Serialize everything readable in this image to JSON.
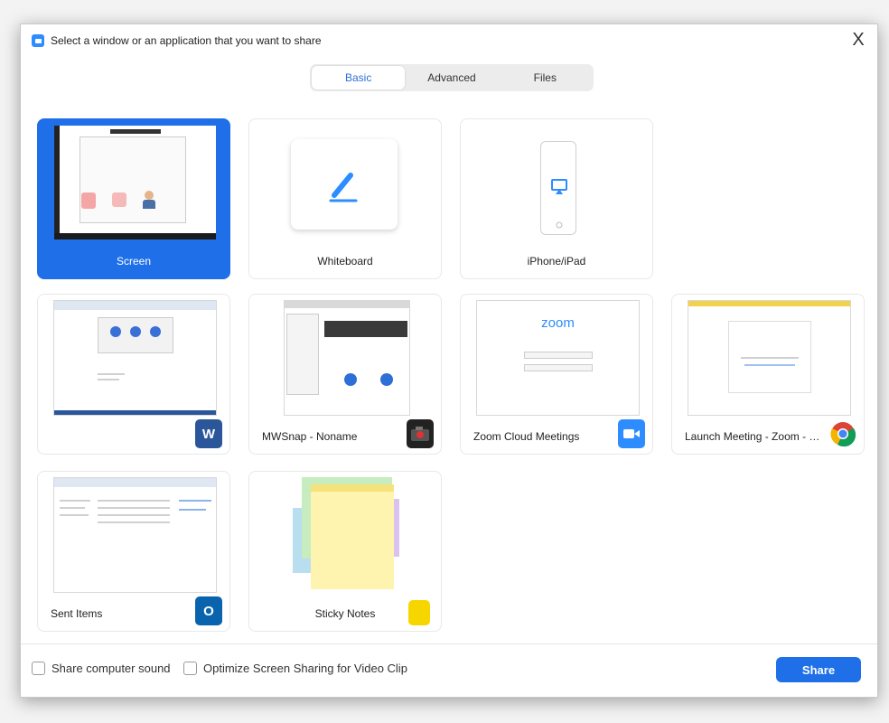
{
  "dialog": {
    "title": "Select a window or an application that you want to share",
    "close_glyph": "X"
  },
  "tabs": [
    {
      "label": "Basic",
      "active": true
    },
    {
      "label": "Advanced",
      "active": false
    },
    {
      "label": "Files",
      "active": false
    }
  ],
  "cards": {
    "screen": {
      "label": "Screen",
      "selected": true
    },
    "whiteboard": {
      "label": "Whiteboard",
      "icon": "pencil-icon"
    },
    "iphone": {
      "label": "iPhone/iPad",
      "icon": "airplay-icon"
    },
    "word": {
      "label": "",
      "badge": "W",
      "badge_color": "#2b579a"
    },
    "mwsnap": {
      "label": "MWSnap - Noname",
      "badge_icon": "camera-icon"
    },
    "zoom": {
      "label": "Zoom Cloud Meetings",
      "logo": "zoom",
      "badge_color": "#2d8cff"
    },
    "chrome": {
      "label": "Launch Meeting - Zoom - Googl...",
      "badge_icon": "chrome-icon"
    },
    "outlook": {
      "label": "Sent Items",
      "badge": "O",
      "badge_color": "#0a64ad"
    },
    "sticky": {
      "label": "Sticky Notes",
      "badge_color": "#f7d600"
    }
  },
  "footer": {
    "share_sound": "Share computer sound",
    "optimize": "Optimize Screen Sharing for Video Clip",
    "share_button": "Share"
  },
  "colors": {
    "accent": "#1e6fe8",
    "tab_active_text": "#2d6fd6"
  }
}
